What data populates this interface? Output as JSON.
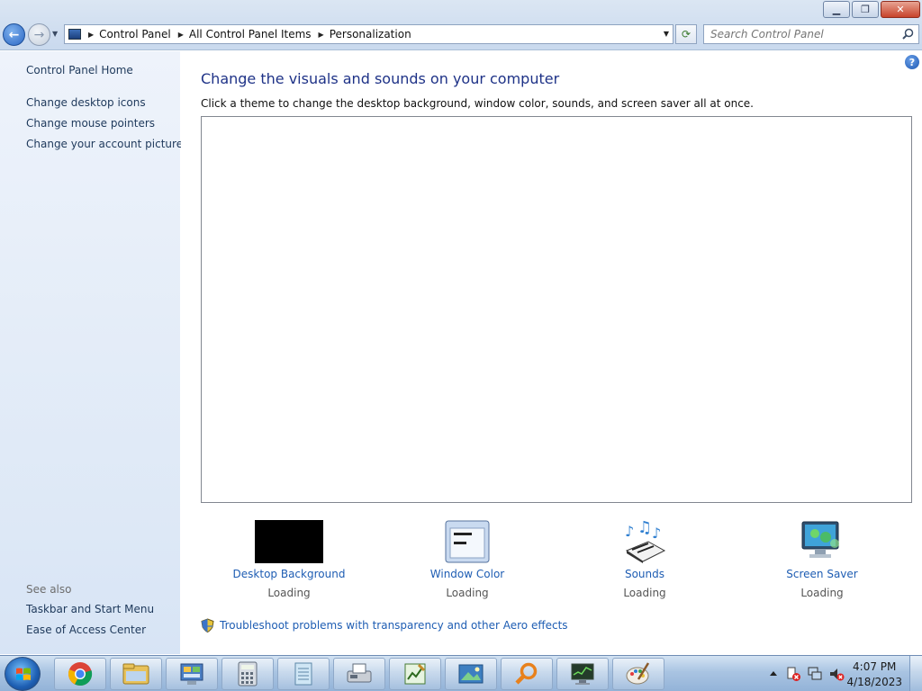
{
  "window": {
    "caption_buttons": {
      "minimize": "▁",
      "restore": "❐",
      "close": "✕"
    }
  },
  "address": {
    "crumbs": [
      "Control Panel",
      "All Control Panel Items",
      "Personalization"
    ]
  },
  "search": {
    "placeholder": "Search Control Panel"
  },
  "left": {
    "home": "Control Panel Home",
    "links": [
      "Change desktop icons",
      "Change mouse pointers",
      "Change your account picture"
    ],
    "see_also_title": "See also",
    "see_also": [
      "Taskbar and Start Menu",
      "Ease of Access Center"
    ]
  },
  "main": {
    "heading": "Change the visuals and sounds on your computer",
    "subtext": "Click a theme to change the desktop background, window color, sounds, and screen saver all at once.",
    "tiles": [
      {
        "name": "Desktop Background",
        "status": "Loading"
      },
      {
        "name": "Window Color",
        "status": "Loading"
      },
      {
        "name": "Sounds",
        "status": "Loading"
      },
      {
        "name": "Screen Saver",
        "status": "Loading"
      }
    ],
    "troubleshoot": "Troubleshoot problems with transparency and other Aero effects"
  },
  "taskbar": {
    "apps": [
      "chrome-icon",
      "explorer-icon",
      "control-panel-icon",
      "calculator-icon",
      "notepad-icon",
      "fax-icon",
      "spreadsheet-icon",
      "photo-icon",
      "search-icon",
      "monitor-icon",
      "paint-icon"
    ],
    "time": "4:07 PM",
    "date": "4/18/2023"
  },
  "colors": {
    "link": "#1e5db3",
    "heading": "#1e3287",
    "left_link": "#1e395b"
  }
}
